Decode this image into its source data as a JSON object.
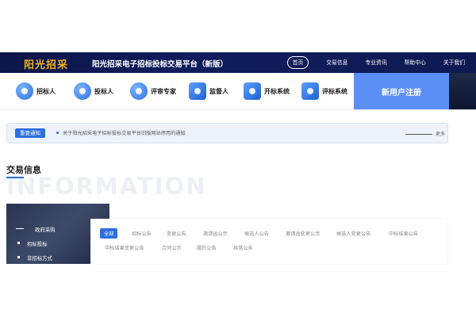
{
  "header": {
    "logo_text": "阳光招采",
    "title": "阳光招采电子招标投标交易平台（新版）",
    "nav": [
      "首页",
      "交易信息",
      "专业资讯",
      "帮助中心",
      "关于我们"
    ],
    "active_nav": "首页"
  },
  "roles": [
    {
      "label": "招标人",
      "icon": "bidder-person-icon"
    },
    {
      "label": "投标人",
      "icon": "tenderer-person-icon"
    },
    {
      "label": "评审专家",
      "icon": "expert-icon"
    },
    {
      "label": "监督人",
      "icon": "supervisor-monitor-icon"
    },
    {
      "label": "开标系统",
      "icon": "opening-system-icon"
    },
    {
      "label": "评标系统",
      "icon": "evaluation-system-icon"
    }
  ],
  "register_label": "新用户注册",
  "notice": {
    "tag": "重要通知",
    "text": "关于阳光招采电子招标投标交易平台旧版网站停用的通知",
    "more": "更多"
  },
  "section": {
    "title": "交易信息",
    "bg_text": "INFORMATION"
  },
  "side_menu": {
    "items": [
      "政府采购",
      "招标投标",
      "非招标方式"
    ]
  },
  "tabs": [
    "全部",
    "招标公告",
    "变更公告",
    "邀请函公示",
    "候选人公告",
    "邀请函变更公示",
    "候选人变更公告",
    "中标结果公告",
    "中标结果变更公告",
    "合同公示",
    "履约公告",
    "异常公告"
  ],
  "active_tab": "全部",
  "colors": {
    "accent": "#2c6fe0",
    "header_bg": "#0e1a52",
    "logo": "#f2b020",
    "register_bg": "#5b8ff5"
  }
}
